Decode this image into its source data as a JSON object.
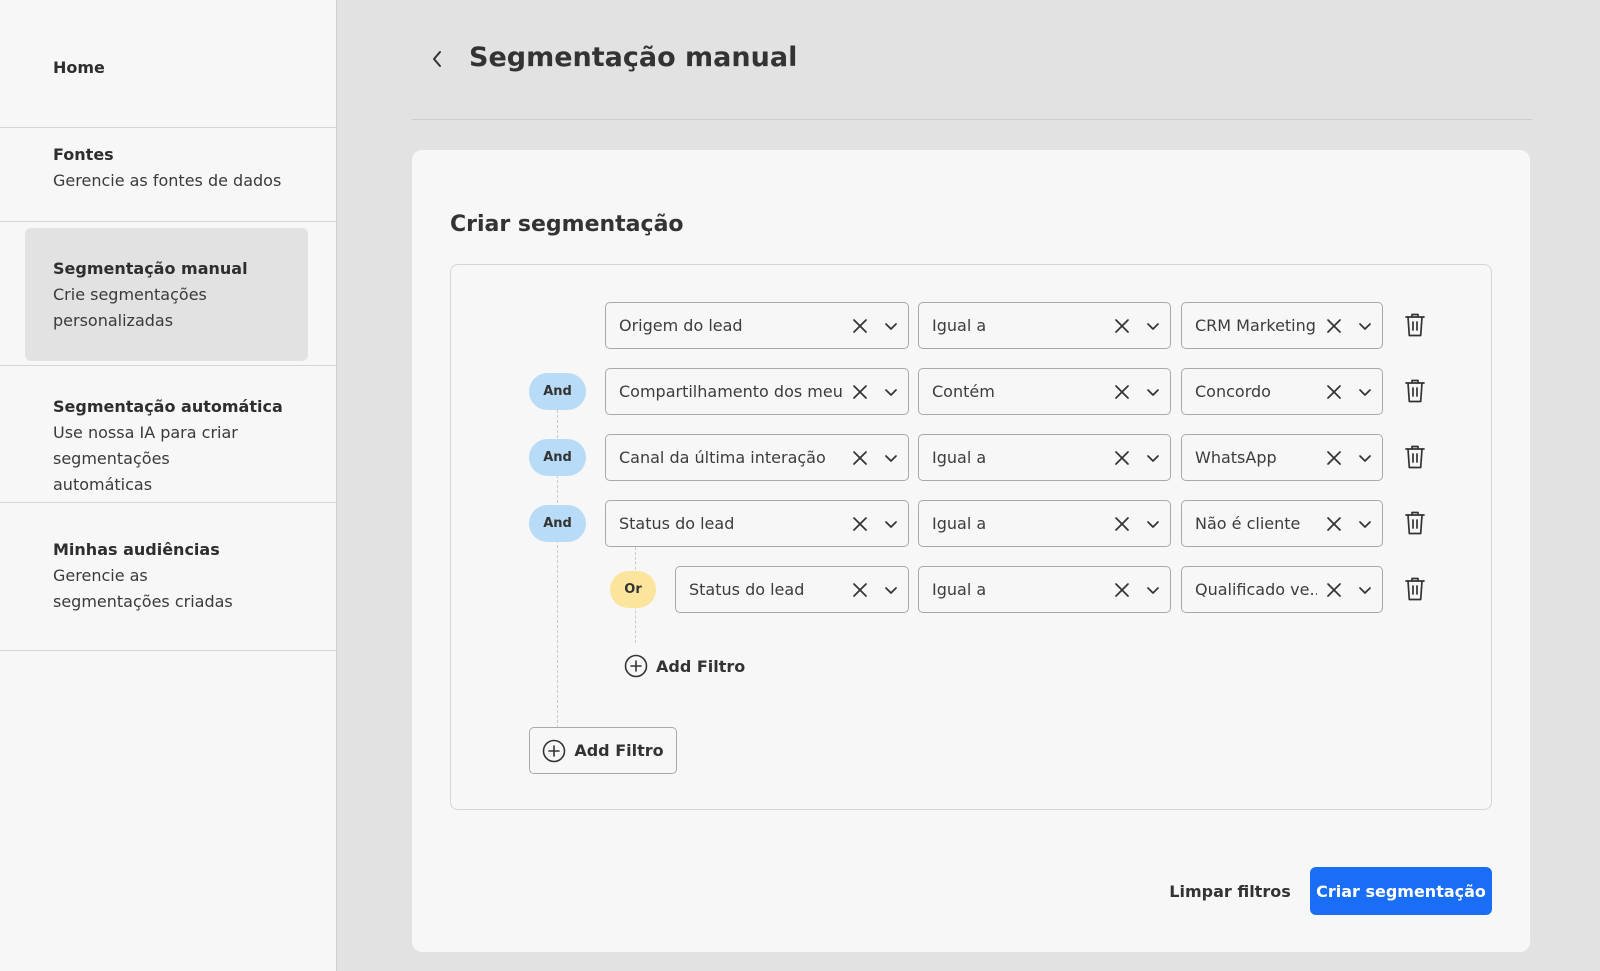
{
  "sidebar": {
    "items": [
      {
        "title": "Home",
        "subtitle": ""
      },
      {
        "title": "Fontes",
        "subtitle": "Gerencie as fontes de dados"
      },
      {
        "title": "Segmentação manual",
        "subtitle": "Crie segmentações personalizadas",
        "active": true
      },
      {
        "title": "Segmentação automática",
        "subtitle": "Use nossa IA para criar segmentações automáticas"
      },
      {
        "title": "Minhas audiências",
        "subtitle": "Gerencie as segmentações criadas"
      }
    ]
  },
  "header": {
    "title": "Segmentação manual"
  },
  "card": {
    "title": "Criar segmentação"
  },
  "filters": [
    {
      "connector": "",
      "field": "Origem do lead",
      "operator": "Igual a",
      "value": "CRM Marketing"
    },
    {
      "connector": "And",
      "field": "Compartilhamento dos meu...",
      "operator": "Contém",
      "value": "Concordo"
    },
    {
      "connector": "And",
      "field": "Canal da última interação",
      "operator": "Igual a",
      "value": "WhatsApp"
    },
    {
      "connector": "And",
      "field": "Status do lead",
      "operator": "Igual a",
      "value": "Não é cliente"
    },
    {
      "connector": "Or",
      "field": "Status do lead",
      "operator": "Igual a",
      "value": "Qualificado ve..."
    }
  ],
  "actions": {
    "add_filter_inline": "Add Filtro",
    "add_filter": "Add Filtro",
    "clear_filters": "Limpar filtros",
    "create_segmentation": "Criar segmentação"
  },
  "colors": {
    "and_badge": "#b8dcf7",
    "or_badge": "#fbe59d",
    "primary": "#1a6ef5"
  }
}
